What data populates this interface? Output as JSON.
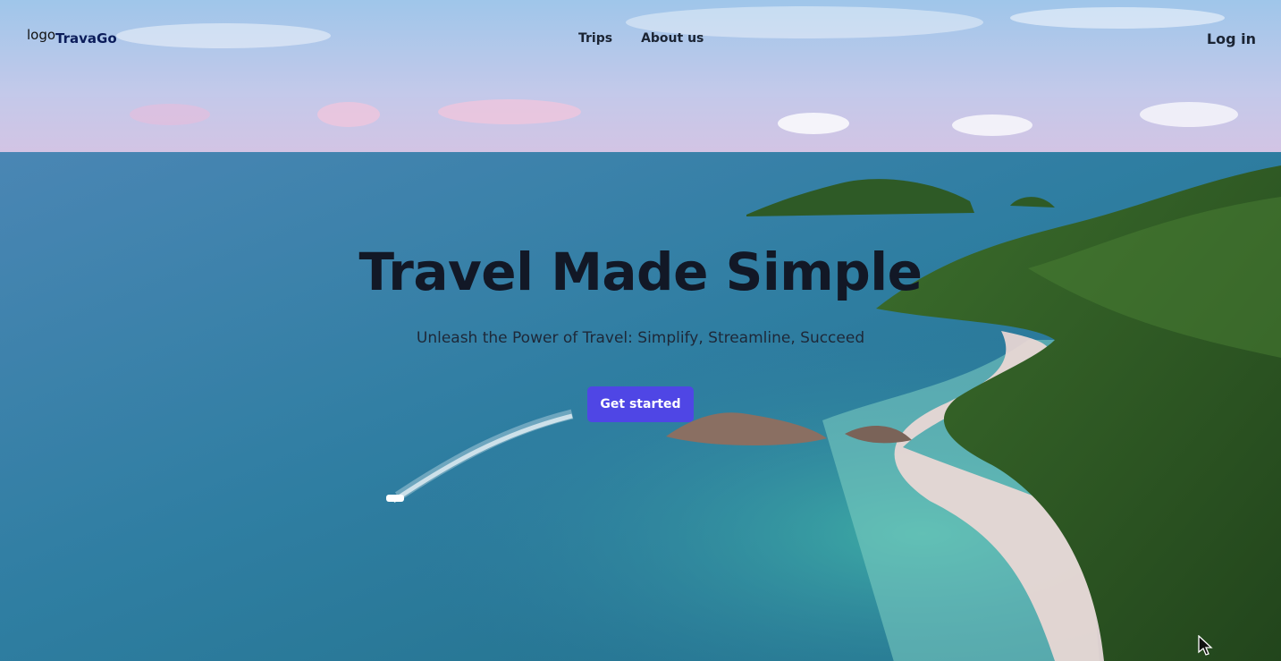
{
  "brand": {
    "logo_alt": "logo",
    "name": "TravaGo"
  },
  "nav": {
    "items": [
      {
        "label": "Trips"
      },
      {
        "label": "About us"
      }
    ]
  },
  "header": {
    "login_label": "Log in"
  },
  "hero": {
    "title": "Travel Made Simple",
    "subtitle": "Unleash the Power of Travel: Simplify, Streamline, Succeed",
    "cta_label": "Get started"
  },
  "colors": {
    "accent": "#4f46e5",
    "title": "#121826",
    "brand": "#0b1c5a"
  },
  "background": {
    "icon": "tropical-coast-aerial-photo"
  }
}
